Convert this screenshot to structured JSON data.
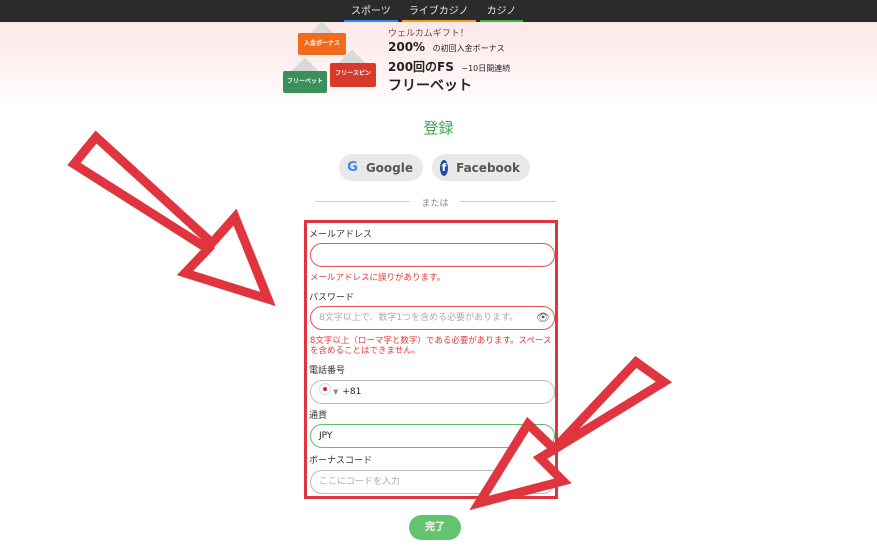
{
  "nav": {
    "sports": "スポーツ",
    "live_casino": "ライブカジノ",
    "casino": "カジノ"
  },
  "promo": {
    "badges": {
      "deposit_bonus": "入金ボーナス",
      "free_spin": "フリースピン",
      "free_bet": "フリーベット"
    },
    "title": "ウェルカムギフト！",
    "line1_value": "200%",
    "line1_text": "の初回入金ボーナス",
    "line2_value": "200回のFS",
    "line2_text": "~10日間連続",
    "line3": "フリーベット"
  },
  "page_title": "登録",
  "social": {
    "google": "Google",
    "facebook": "Facebook",
    "google_icon": "google-icon",
    "facebook_icon": "facebook-icon"
  },
  "divider_text": "または",
  "form": {
    "email_label": "メールアドレス",
    "email_value": "",
    "email_error": "メールアドレスに誤りがあります。",
    "password_label": "パスワード",
    "password_placeholder": "8文字以上で、数字1つを含める必要があります。",
    "password_error": "8文字以上（ローマ字と数字）である必要があります。スペースを含めることはできません。",
    "phone_label": "電話番号",
    "phone_code": "+81",
    "currency_label": "通貨",
    "currency_value": "JPY",
    "bonus_label": "ボーナスコード",
    "bonus_placeholder": "ここにコードを入力"
  },
  "submit_label": "完了",
  "colors": {
    "accent_green": "#3aa64a",
    "error_red": "#e03a3a",
    "annotation_red": "#e0343f"
  }
}
